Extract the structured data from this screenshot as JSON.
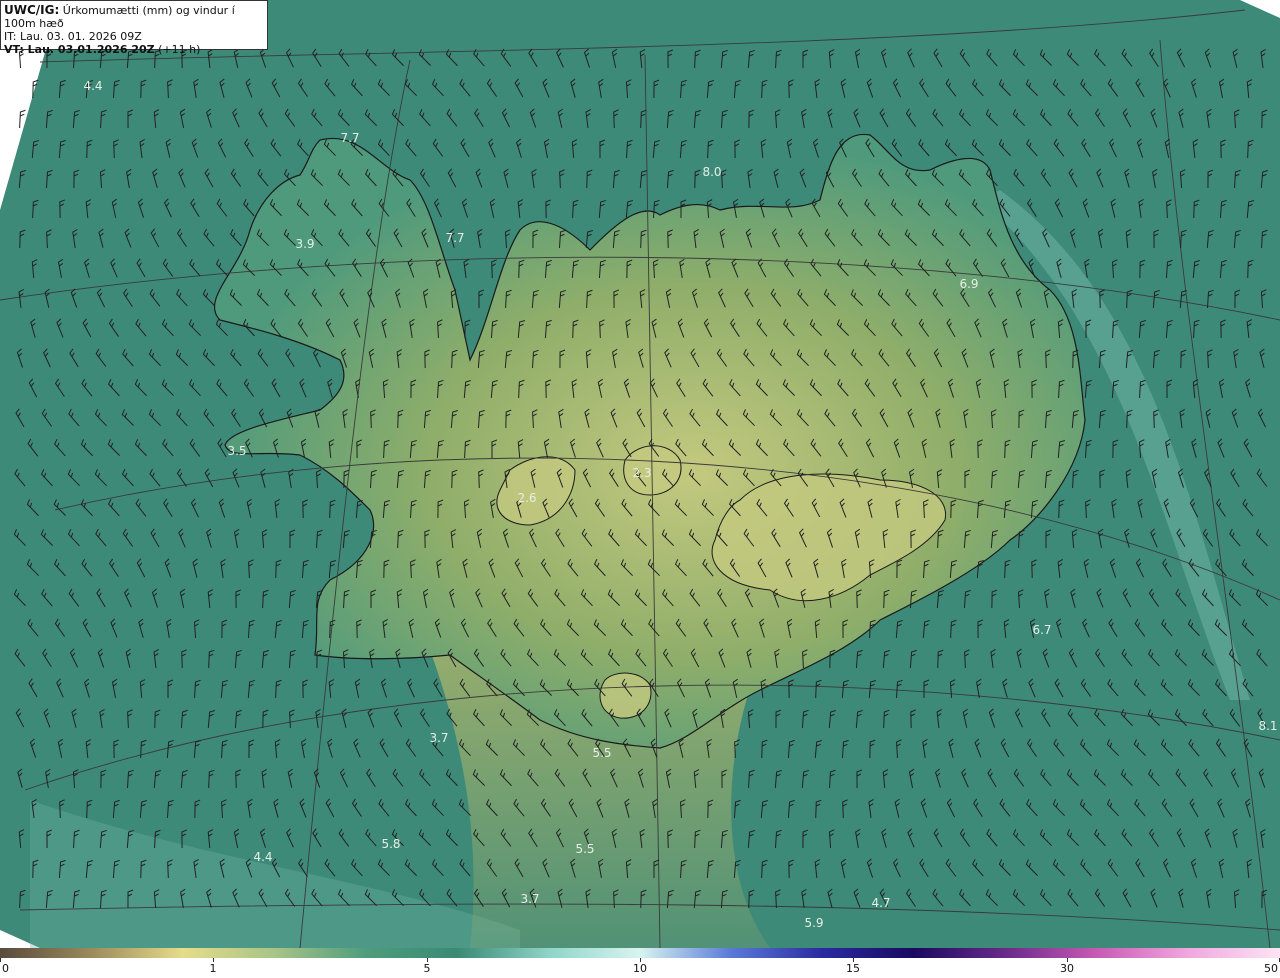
{
  "header": {
    "title_bold": "UWC/IG:",
    "title_rest": " Úrkomumætti (mm) og vindur í 100m hæð",
    "it_line": "IT: Lau. 03. 01. 2026 09Z",
    "vt_bold": "VT: Lau. 03.01.2026 20Z",
    "vt_rest": " (+11 h)"
  },
  "map": {
    "colors": {
      "sea": "#3e8a78",
      "sea_light": "#6db3a3",
      "land_low": "#4f9a7c",
      "land_mid": "#8fae6a",
      "land_high": "#c4c97f",
      "coast": "#1a1a1a",
      "grid": "#3a3a3a",
      "barb": "#222222"
    },
    "value_labels": [
      "4.4",
      "7.7",
      "3.9",
      "7.7",
      "8.0",
      "6.9",
      "3.5",
      "2.6",
      "2.3",
      "6.7",
      "8.1",
      "3.7",
      "5.5",
      "4.4",
      "5.8",
      "5.5",
      "3.7",
      "4.7",
      "5.9"
    ]
  },
  "colorbar": {
    "ticks": [
      {
        "label": "0",
        "frac": 0.0
      },
      {
        "label": "1",
        "frac": 0.1667
      },
      {
        "label": "5",
        "frac": 0.3333
      },
      {
        "label": "10",
        "frac": 0.5
      },
      {
        "label": "15",
        "frac": 0.6667
      },
      {
        "label": "30",
        "frac": 0.8333
      },
      {
        "label": "50",
        "frac": 1.0
      }
    ],
    "stops": [
      "#5a4a3c",
      "#9a8a5c",
      "#e6dc8a",
      "#a8c488",
      "#4f9c7c",
      "#3a8a74",
      "#8fd4c8",
      "#d8f4f0",
      "#5a7ad8",
      "#2a2aa0",
      "#1a0a60",
      "#6a2a8a",
      "#c85ab4",
      "#f0a8e0",
      "#fce4f4"
    ]
  }
}
